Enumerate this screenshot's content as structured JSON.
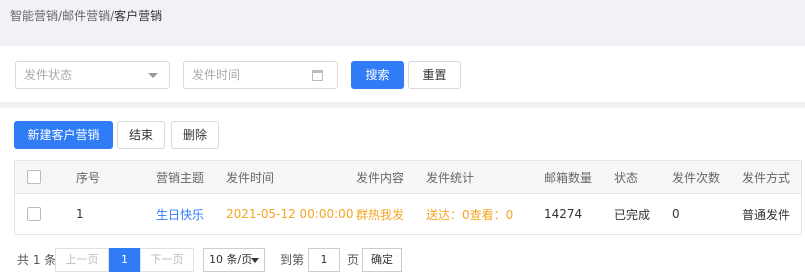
{
  "breadcrumb": {
    "parts": [
      "智能营销",
      "邮件营销"
    ],
    "separator": "/",
    "current": "客户营销"
  },
  "filters": {
    "status_placeholder": "发件状态",
    "time_placeholder": "发件时间",
    "search_label": "搜索",
    "reset_label": "重置"
  },
  "toolbar": {
    "new_label": "新建客户营销",
    "end_label": "结束",
    "delete_label": "删除"
  },
  "table": {
    "headers": [
      "序号",
      "营销主题",
      "发件时间",
      "发件内容",
      "发件统计",
      "邮箱数量",
      "状态",
      "发件次数",
      "发件方式"
    ],
    "rows": [
      {
        "index": "1",
        "subject": "生日快乐",
        "time": "2021-05-12 00:00:00",
        "content": "群热我发",
        "stats": "送达：0查看：0",
        "email_count": "14274",
        "status": "已完成",
        "send_count": "0",
        "send_method": "普通发件"
      }
    ]
  },
  "pagination": {
    "total": "共 1 条",
    "prev": "上一页",
    "current_page": "1",
    "next": "下一页",
    "page_size": "10 条/页",
    "goto_label": "到第",
    "goto_value": "1",
    "page_unit": "页",
    "confirm": "确定"
  },
  "colors": {
    "primary": "#2f7cf6",
    "link": "#2f7cf6",
    "highlight": "#f5a623"
  }
}
